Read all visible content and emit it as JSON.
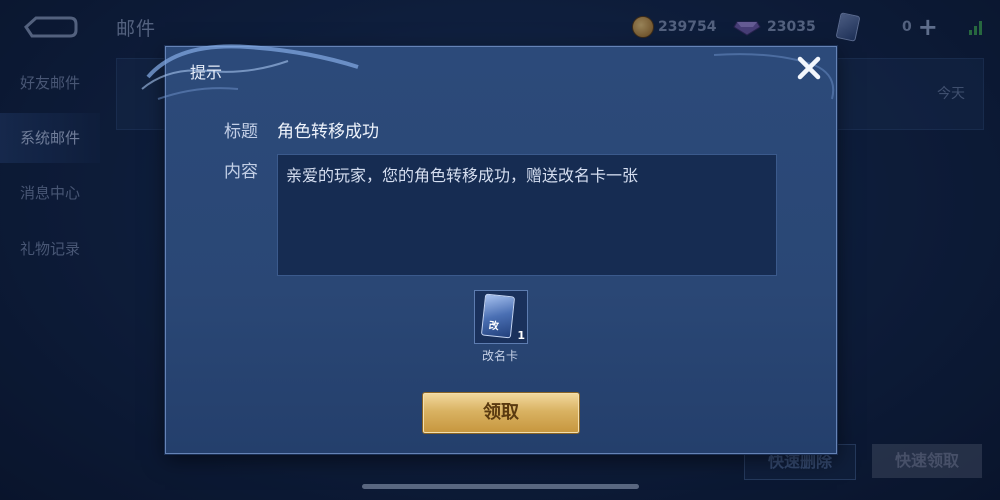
{
  "header": {
    "title": "邮件",
    "gold": "239754",
    "gems": "23035",
    "cards": "0"
  },
  "sidebar": {
    "items": [
      {
        "label": "好友邮件"
      },
      {
        "label": "系统邮件"
      },
      {
        "label": "消息中心"
      },
      {
        "label": "礼物记录"
      }
    ],
    "active_index": 1
  },
  "mail_list": {
    "date": "今天"
  },
  "footer": {
    "quick_delete": "快速删除",
    "quick_claim": "快速领取"
  },
  "dialog": {
    "title": "提示",
    "subject_label": "标题",
    "subject": "角色转移成功",
    "content_label": "内容",
    "content": "亲爱的玩家，您的角色转移成功，赠送改名卡一张",
    "attachment": {
      "name": "改名卡",
      "icon_char": "改",
      "count": "1"
    },
    "claim_label": "领取"
  },
  "colors": {
    "accent_gold": "#d9b262",
    "panel": "#2c4a7a",
    "background": "#13284d"
  },
  "icons": [
    "back-arrow-icon",
    "coin-icon",
    "gem-icon",
    "card-icon",
    "plus-icon",
    "signal-icon",
    "close-icon",
    "rename-card-icon"
  ]
}
